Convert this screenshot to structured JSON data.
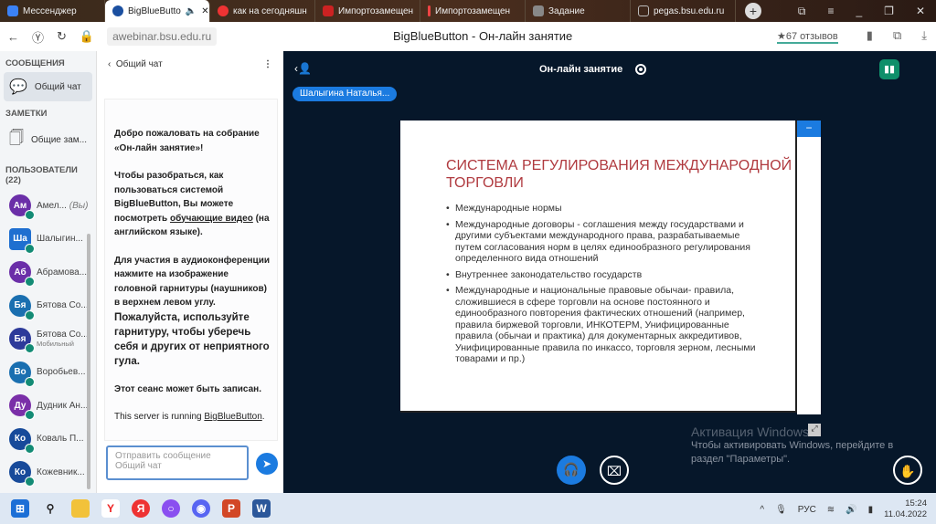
{
  "browser": {
    "tabs": [
      {
        "label": "Мессенджер",
        "color": "#3b82f6"
      },
      {
        "label": "BigBlueButto",
        "color": "#1b4fa0",
        "active": true
      },
      {
        "label": "как на сегодняшн",
        "color": "#e33"
      },
      {
        "label": "Импортозамещен",
        "color": "#c22"
      },
      {
        "label": "Импортозамещен",
        "color": "#e44"
      },
      {
        "label": "Задание",
        "color": "#888"
      },
      {
        "label": "pegas.bsu.edu.ru",
        "color": "#999"
      }
    ],
    "url": "awebinar.bsu.edu.ru",
    "page_title": "BigBlueButton - Он-лайн занятие",
    "reviews": "★67 отзывов"
  },
  "sidebar": {
    "messages_heading": "СООБЩЕНИЯ",
    "public_chat": "Общий чат",
    "notes_heading": "ЗАМЕТКИ",
    "shared_notes": "Общие зам...",
    "users_heading": "ПОЛЬЗОВАТЕЛИ (22)",
    "users": [
      {
        "initials": "Ам",
        "name": "Амел...",
        "you": "(Вы)",
        "color": "#6b2fa8"
      },
      {
        "initials": "Ша",
        "name": "Шалыгин...",
        "color": "#1f6fd0",
        "presenter": true
      },
      {
        "initials": "Аб",
        "name": "Абрамова...",
        "color": "#6b2fa8"
      },
      {
        "initials": "Бя",
        "name": "Бятова Со...",
        "color": "#1a6fb0"
      },
      {
        "initials": "Бя",
        "name": "Бятова Со...",
        "sub": "Мобильный",
        "color": "#2d3a9a"
      },
      {
        "initials": "Во",
        "name": "Воробьев...",
        "color": "#1a6fb0"
      },
      {
        "initials": "Ду",
        "name": "Дудник Ан...",
        "color": "#7a2fa8"
      },
      {
        "initials": "Ко",
        "name": "Коваль П...",
        "color": "#174a9a"
      },
      {
        "initials": "Ко",
        "name": "Кожевник...",
        "color": "#174a9a"
      }
    ]
  },
  "chat": {
    "title": "Общий чат",
    "welcome_1": "Добро пожаловать на собрание «Он-лайн занятие»!",
    "intro_a": "Чтобы разобраться, как пользоваться системой BigBlueButton, Вы можете посмотреть ",
    "intro_link": "обучающие видео",
    "intro_b": " (на английском языке).",
    "audio": "Для участия в аудиоконференции нажмите на изображение головной гарнитуры (наушников) в верхнем левом углу.",
    "headset": "Пожалуйста, используйте гарнитуру, чтобы уберечь себя и других от неприятного гула.",
    "recorded": "Этот сеанс может быть записан.",
    "server_a": "This server is running ",
    "server_link": "BigBlueButton",
    "server_b": ".",
    "placeholder": "Отправить сообщение Общий чат"
  },
  "main": {
    "meeting_title": "Он-лайн занятие",
    "presenter": "Шалыгина Наталья...",
    "slide": {
      "title": "СИСТЕМА РЕГУЛИРОВАНИЯ МЕЖДУНАРОДНОЙ ТОРГОВЛИ",
      "bullets": [
        "Международные нормы",
        "Международные договоры - соглашения между государствами и другими субъектами международного права, разрабатываемые путем согласования норм в целях единообразного регулирования определенного вида отношений",
        "Внутреннее законодательство государств",
        "Международные и национальные правовые обычаи- правила, сложившиеся в сфере торговли на основе постоянного и единообразного повторения фактических отношений (например, правила биржевой торговли, ИНКОТЕРМ, Унифицированные правила (обычаи и практика) для документарных аккредитивов, Унифицированные правила по инкассо, торговля зерном, лесными товарами и пр.)"
      ]
    },
    "activation_title": "Активация Windows",
    "activation_text": "Чтобы активировать Windows, перейдите в раздел \"Параметры\"."
  },
  "taskbar": {
    "lang": "РУС",
    "time": "15:24",
    "date": "11.04.2022"
  }
}
